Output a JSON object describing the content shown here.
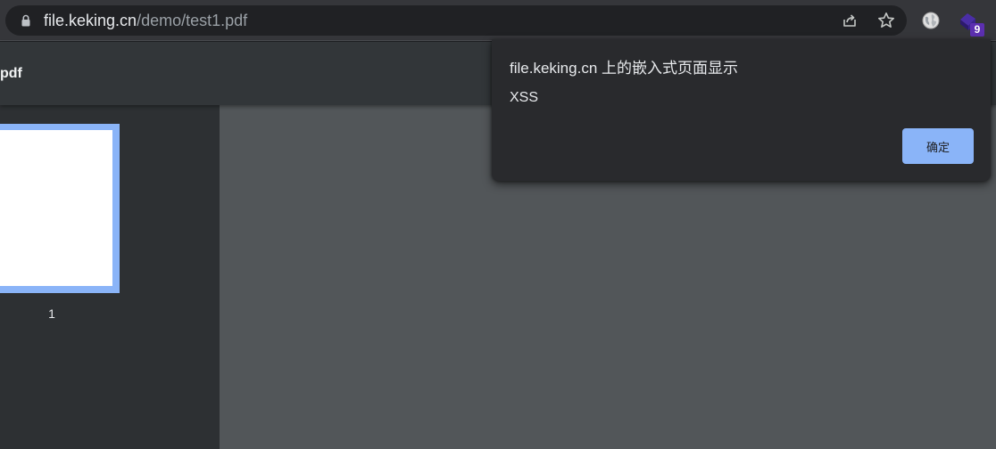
{
  "address_bar": {
    "url_host": "file.keking.cn",
    "url_path": "/demo/test1.pdf",
    "icons": {
      "lock": "lock-icon",
      "share": "share-icon",
      "bookmark": "star-icon"
    }
  },
  "extensions": {
    "first_icon": "globe-icon",
    "second_icon": "puzzle-extension-icon",
    "badge_count": "9",
    "badge_color": "#5c2fb0"
  },
  "pdf_viewer": {
    "title": "pdf",
    "thumbnails": [
      {
        "page_number": "1",
        "selected": true
      }
    ],
    "colors": {
      "toolbar": "#323639",
      "sidebar": "#2d3033",
      "canvas": "#525659",
      "thumbnail_selection": "#8ab4f8"
    }
  },
  "dialog": {
    "title": "file.keking.cn 上的嵌入式页面显示",
    "message": "XSS",
    "ok_label": "确定",
    "accent": "#8ab4f8"
  }
}
